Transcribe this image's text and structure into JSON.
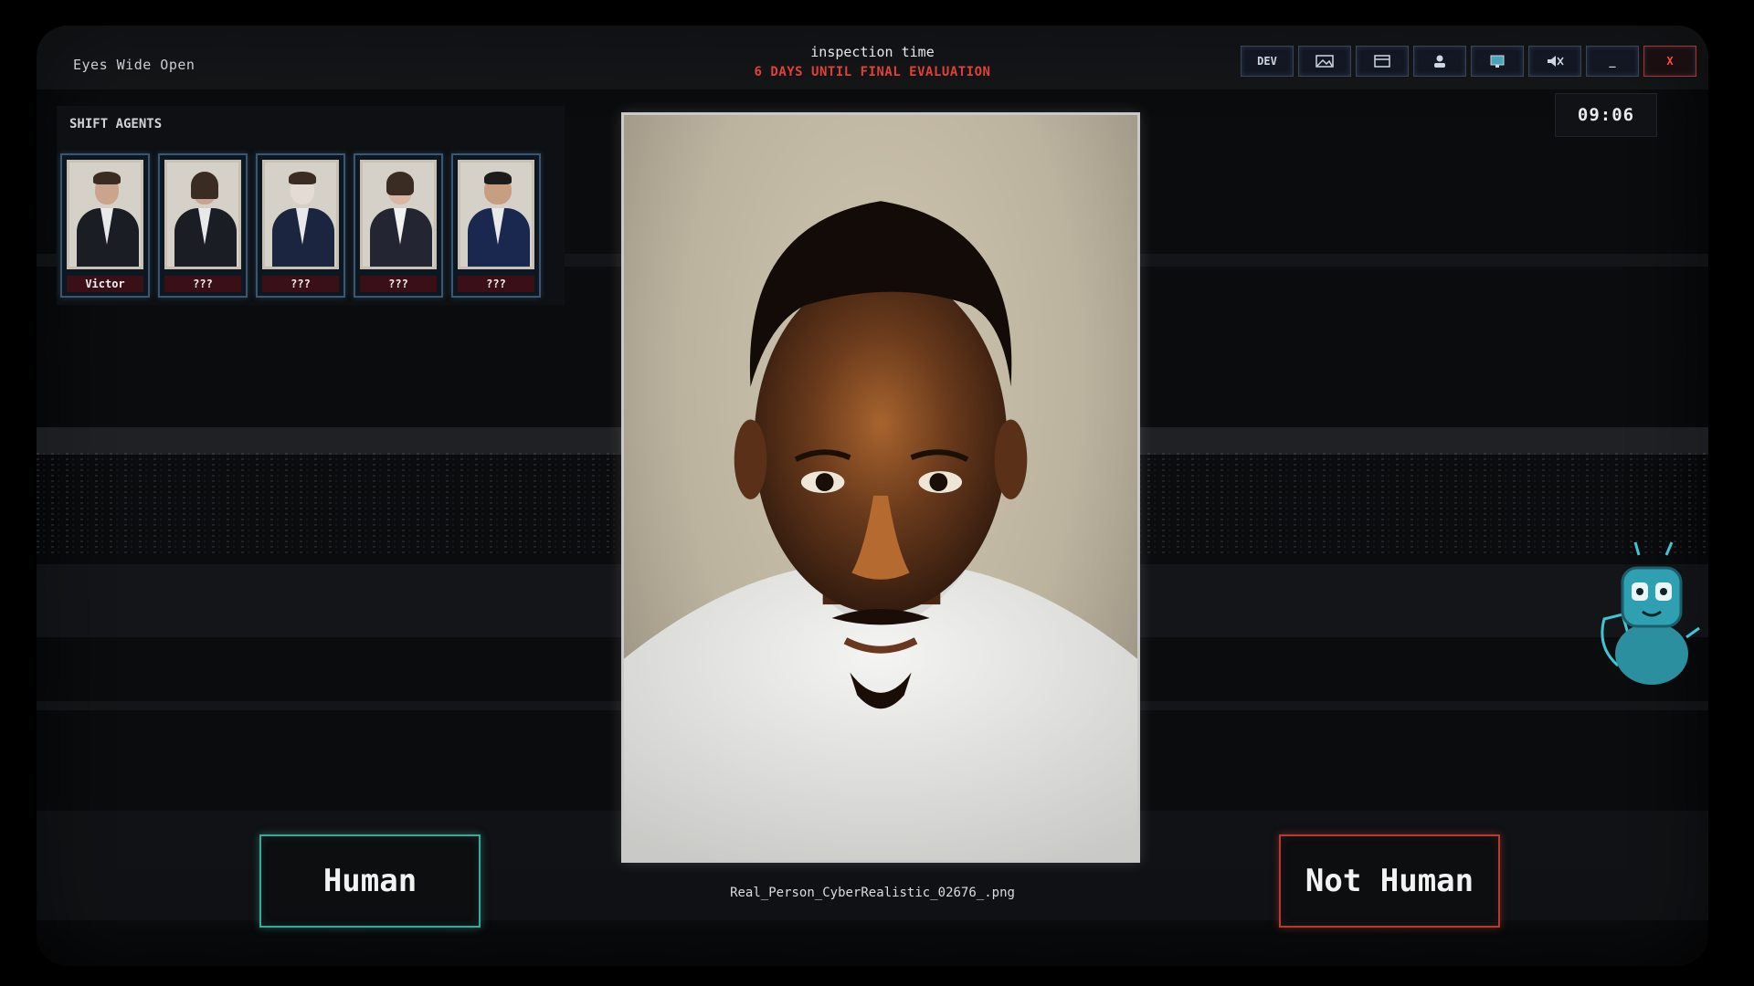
{
  "app": {
    "title": "Eyes Wide Open"
  },
  "header": {
    "title": "inspection time",
    "subtitle": "6 DAYS UNTIL FINAL EVALUATION"
  },
  "toolbar": {
    "buttons": [
      {
        "label": "DEV",
        "icon": "dev-icon"
      },
      {
        "label": "",
        "icon": "image-icon"
      },
      {
        "label": "",
        "icon": "window-icon"
      },
      {
        "label": "",
        "icon": "user-icon"
      },
      {
        "label": "",
        "icon": "monitor-icon"
      },
      {
        "label": "",
        "icon": "mute-icon"
      },
      {
        "label": "_",
        "icon": "minimize-icon"
      },
      {
        "label": "X",
        "icon": "close-icon"
      }
    ]
  },
  "clock": {
    "time": "09:06"
  },
  "agents": {
    "label": "SHIFT AGENTS",
    "items": [
      {
        "name": "Victor"
      },
      {
        "name": "???"
      },
      {
        "name": "???"
      },
      {
        "name": "???"
      },
      {
        "name": "???"
      }
    ]
  },
  "inspection": {
    "filename": "Real_Person_CyberRealistic_02676_.png"
  },
  "actions": {
    "human_label": "Human",
    "not_human_label": "Not Human"
  },
  "colors": {
    "accent_human": "#3aa89a",
    "accent_not_human": "#b63a2e",
    "warning": "#e0403a"
  }
}
